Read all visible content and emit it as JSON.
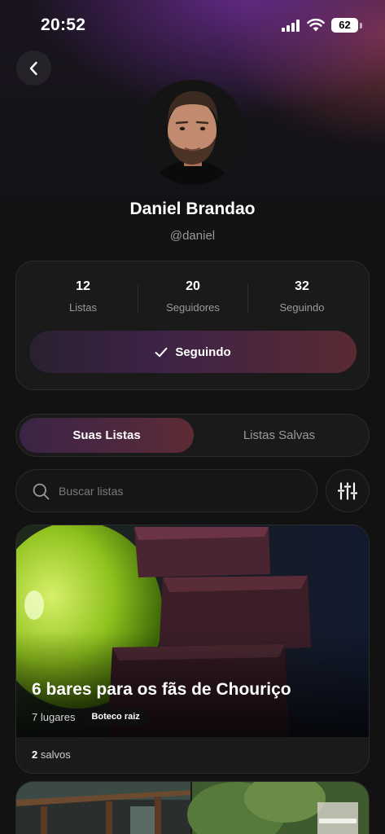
{
  "status_bar": {
    "time": "20:52",
    "battery": "62"
  },
  "profile": {
    "name": "Daniel Brandao",
    "handle": "@daniel"
  },
  "stats": [
    {
      "value": "12",
      "label": "Listas"
    },
    {
      "value": "20",
      "label": "Seguidores"
    },
    {
      "value": "32",
      "label": "Seguindo"
    }
  ],
  "follow_button": {
    "label": "Seguindo"
  },
  "tabs": [
    {
      "label": "Suas Listas",
      "active": true
    },
    {
      "label": "Listas Salvas",
      "active": false
    }
  ],
  "search": {
    "placeholder": "Buscar listas"
  },
  "lists": [
    {
      "title": "6 bares para os fãs de Chouriço",
      "places": "7 lugares",
      "tag": "Boteco raiz",
      "saves_count": "2",
      "saves_label": "salvos"
    }
  ],
  "colors": {
    "background": "#121212",
    "accent_purple": "#3d2346",
    "accent_red": "#5a2a33"
  },
  "icons": [
    "back-chevron-icon",
    "signal-icon",
    "wifi-icon",
    "battery-icon",
    "check-icon",
    "search-icon",
    "sliders-icon"
  ]
}
